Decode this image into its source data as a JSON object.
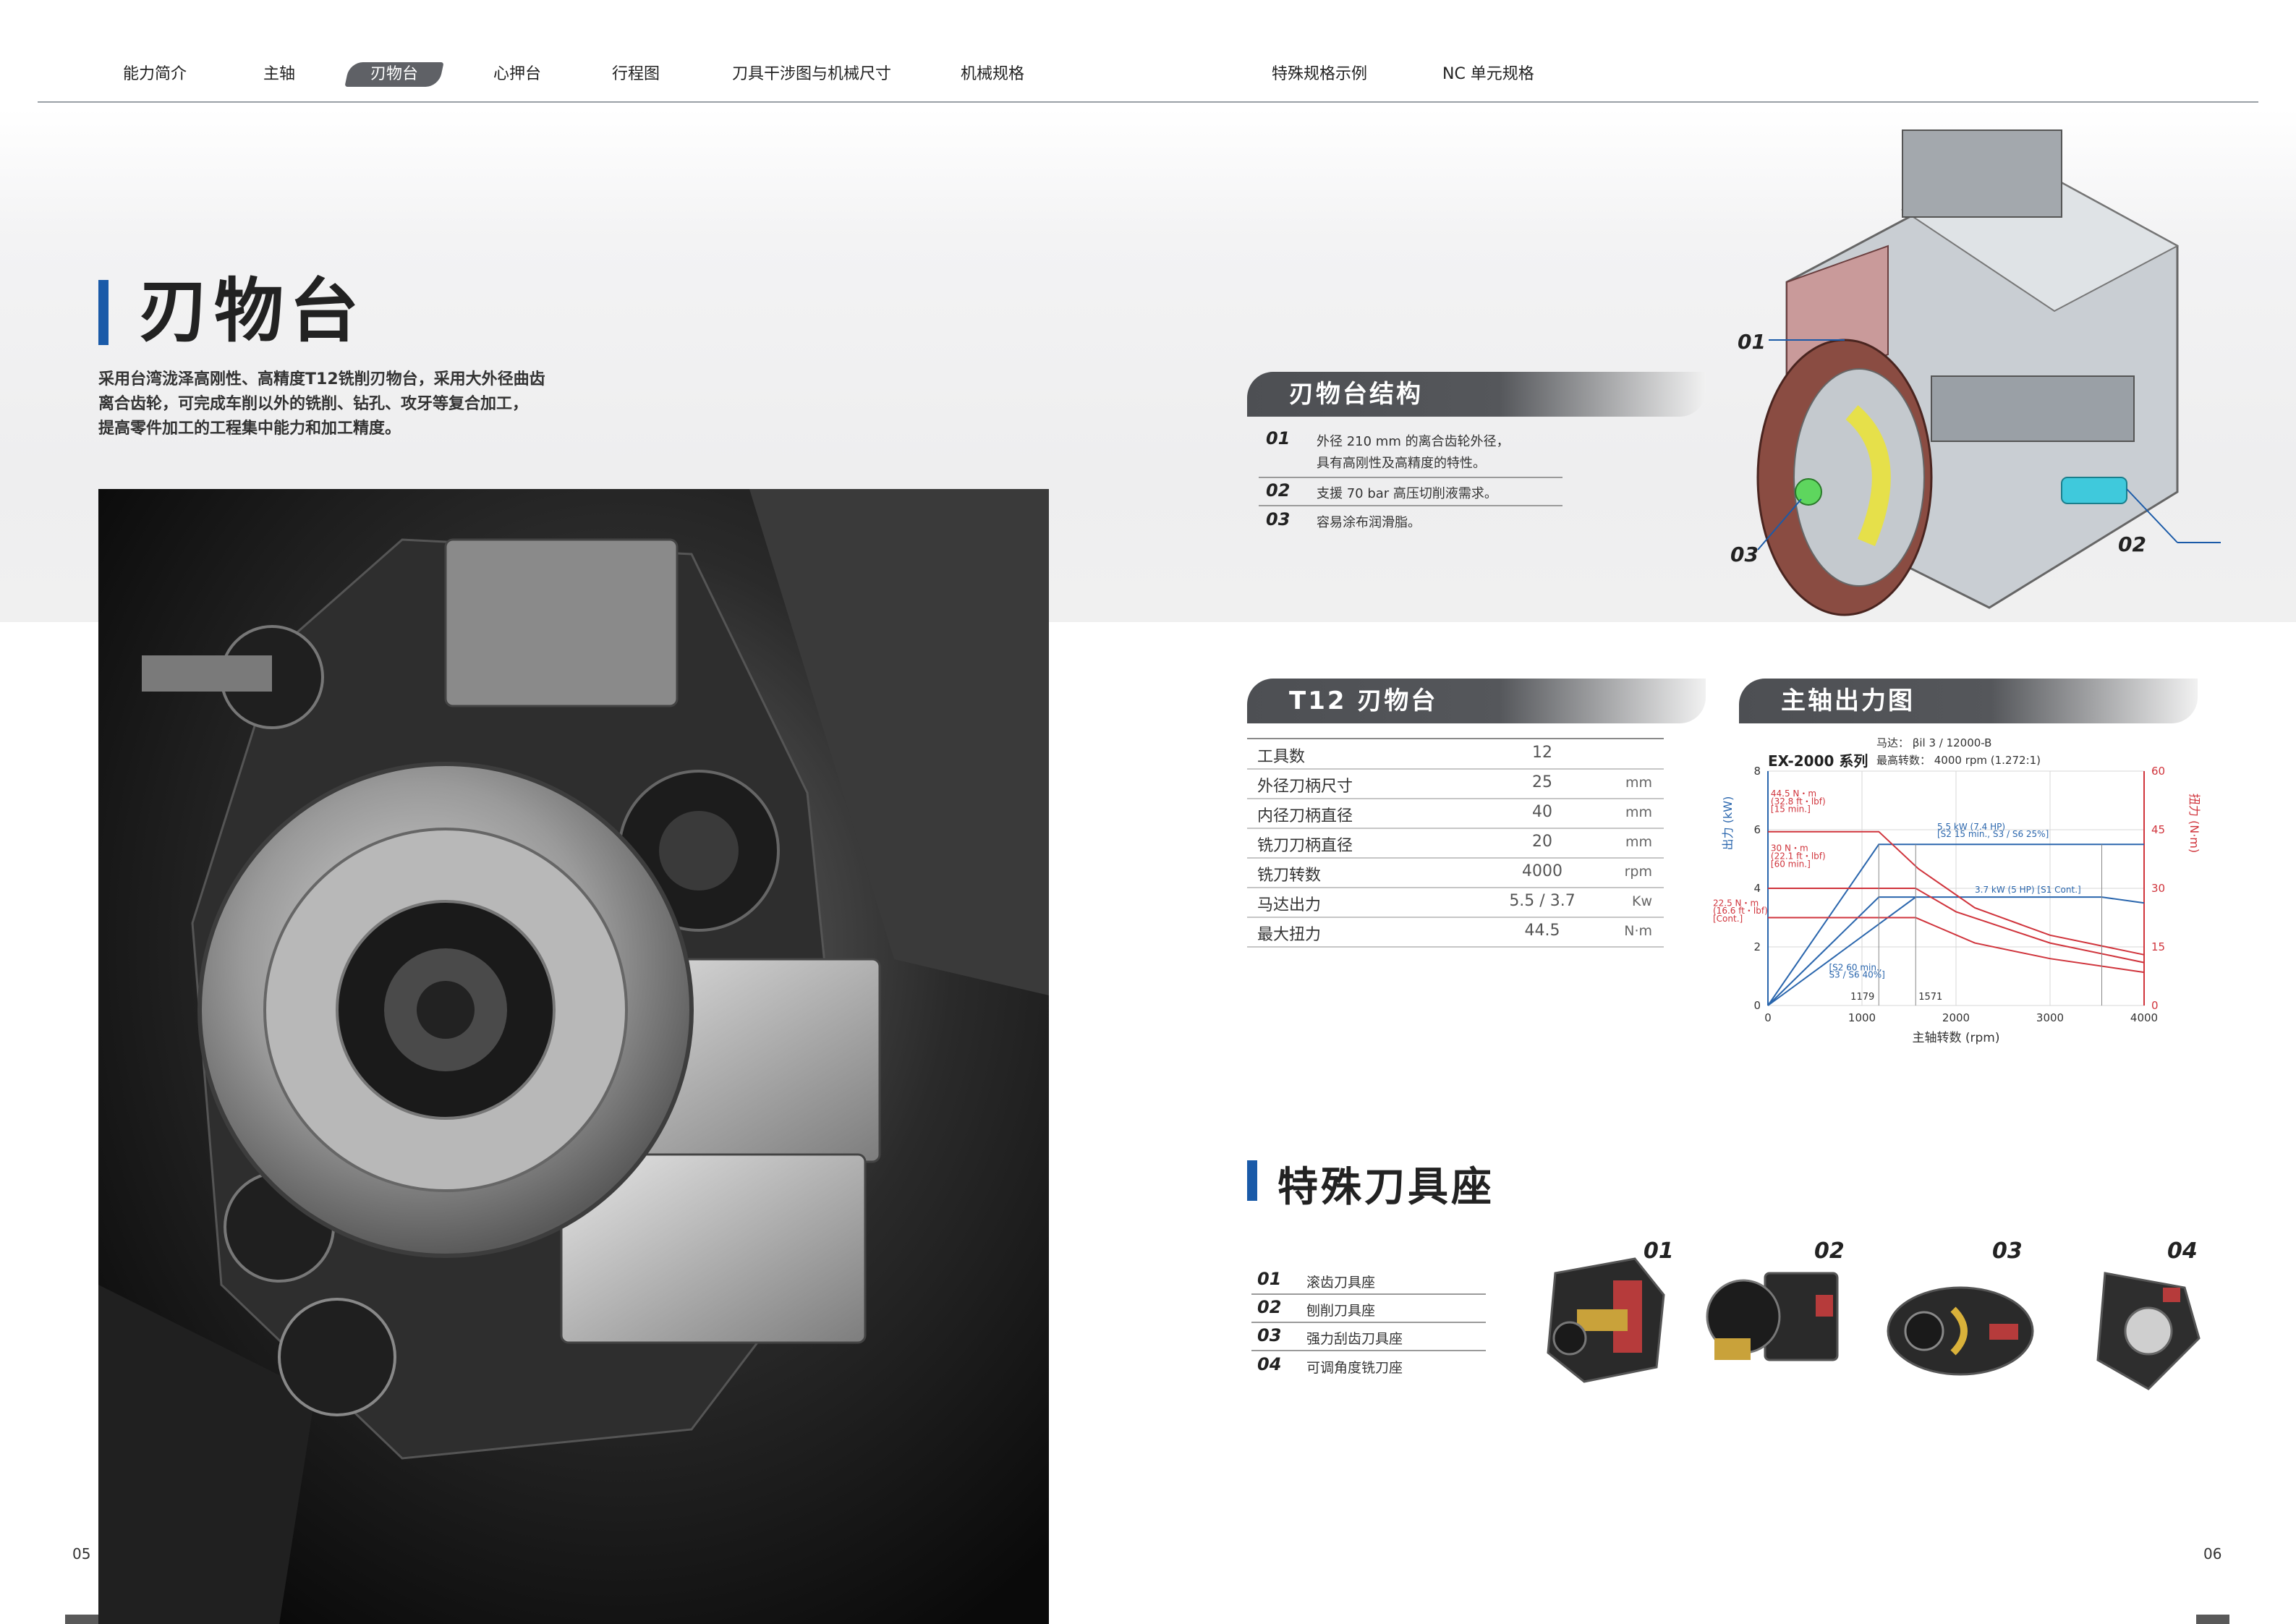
{
  "nav": {
    "items": [
      "能力简介",
      "主轴",
      "刃物台",
      "心押台",
      "行程图",
      "刀具干涉图与机械尺寸",
      "机械规格",
      "特殊规格示例",
      "NC 单元规格"
    ],
    "active_index": 2
  },
  "page": {
    "title": "刃物台",
    "intro": [
      "采用台湾泷泽高刚性、高精度T12铣削刃物台，采用大外径曲齿",
      "离合齿轮，可完成车削以外的铣削、钻孔、攻牙等复合加工，",
      "提高零件加工的工程集中能力和加工精度。"
    ],
    "page_left": "05",
    "page_right": "06"
  },
  "structure": {
    "title": "刃物台结构",
    "items": [
      {
        "num": "01",
        "lines": [
          "外径 210 mm 的离合齿轮外径，",
          "具有高刚性及高精度的特性。"
        ]
      },
      {
        "num": "02",
        "lines": [
          "支援 70 bar 高压切削液需求。"
        ]
      },
      {
        "num": "03",
        "lines": [
          "容易涂布润滑脂。"
        ]
      }
    ],
    "callouts": [
      "01",
      "02",
      "03"
    ]
  },
  "turret": {
    "title": "T12 刃物台",
    "rows": [
      {
        "label": "工具数",
        "value": "12",
        "unit": ""
      },
      {
        "label": "外径刀柄尺寸",
        "value": "25",
        "unit": "mm"
      },
      {
        "label": "内径刀柄直径",
        "value": "40",
        "unit": "mm"
      },
      {
        "label": "铣刀刀柄直径",
        "value": "20",
        "unit": "mm"
      },
      {
        "label": "铣刀转数",
        "value": "4000",
        "unit": "rpm"
      },
      {
        "label": "马达出力",
        "value": "5.5 / 3.7",
        "unit": "Kw"
      },
      {
        "label": "最大扭力",
        "value": "44.5",
        "unit": "N·m"
      }
    ]
  },
  "chart_data": {
    "type": "line",
    "title": "主轴出力图",
    "series_title": "EX-2000 系列",
    "motor_line": "马达： βil 3 / 12000-B",
    "speed_line": "最高转数： 4000 rpm (1.272:1)",
    "xlabel": "主轴转数 (rpm)",
    "ylabel_left": "出力 (kW)",
    "ylabel_right": "扭力 (N·m)",
    "xlim": [
      0,
      4000
    ],
    "ylim_left": [
      0,
      8
    ],
    "ylim_right": [
      0,
      60
    ],
    "x_ticks": [
      "0",
      "1000",
      "2000",
      "3000",
      "4000"
    ],
    "y_ticks_left": [
      "0",
      "2",
      "4",
      "6",
      "8"
    ],
    "y_ticks_right": [
      "0",
      "15",
      "30",
      "45",
      "60"
    ],
    "markers": [
      "1179",
      "1571"
    ],
    "annotations": [
      "44.5 N・m",
      "(32.8 ft・lbf)",
      "[15 min.]",
      "30 N・m",
      "(22.1 ft・lbf)",
      "[60 min.]",
      "22.5 N・m",
      "(16.6 ft・lbf)",
      "[Cont.]",
      "5.5 kW (7.4 HP)",
      "[S2 15 min., S3 / S6 25%]",
      "3.7 kW (5 HP) [S1 Cont.]",
      "[S2 60 min.,",
      "S3 / S6 40%]"
    ],
    "power_series": [
      {
        "name": "S2 15min",
        "points": [
          [
            0,
            0
          ],
          [
            1179,
            5.5
          ],
          [
            3550,
            5.5
          ],
          [
            4000,
            5.5
          ]
        ]
      },
      {
        "name": "S1 Cont.",
        "points": [
          [
            0,
            0
          ],
          [
            1571,
            3.7
          ],
          [
            3550,
            3.7
          ],
          [
            4000,
            3.5
          ]
        ]
      },
      {
        "name": "S2 60min",
        "points": [
          [
            0,
            0
          ],
          [
            1179,
            3.7
          ],
          [
            1571,
            3.7
          ]
        ]
      }
    ],
    "torque_series": [
      {
        "name": "44.5",
        "points": [
          [
            0,
            44.5
          ],
          [
            1179,
            44.5
          ],
          [
            1600,
            35
          ],
          [
            2200,
            25
          ],
          [
            3000,
            18
          ],
          [
            4000,
            13
          ]
        ]
      },
      {
        "name": "30",
        "points": [
          [
            0,
            30
          ],
          [
            1571,
            30
          ],
          [
            2000,
            24
          ],
          [
            3000,
            16
          ],
          [
            4000,
            11
          ]
        ]
      },
      {
        "name": "22.5",
        "points": [
          [
            0,
            22.5
          ],
          [
            1571,
            22.5
          ],
          [
            2200,
            16
          ],
          [
            3000,
            12
          ],
          [
            4000,
            8.5
          ]
        ]
      }
    ],
    "colors": {
      "power": "#2a66ad",
      "torque": "#d0343c",
      "grid": "#d7d7d7"
    }
  },
  "special_tools": {
    "title": "特殊刀具座",
    "items": [
      {
        "num": "01",
        "label": "滚齿刀具座"
      },
      {
        "num": "02",
        "label": "刨削刀具座"
      },
      {
        "num": "03",
        "label": "强力刮齿刀具座"
      },
      {
        "num": "04",
        "label": "可调角度铣刀座"
      }
    ]
  }
}
